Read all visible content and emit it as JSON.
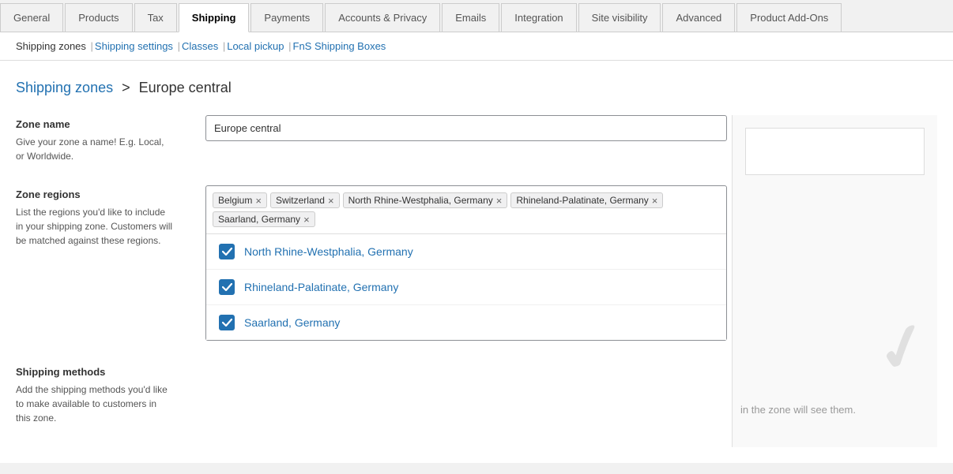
{
  "tabs": [
    {
      "id": "general",
      "label": "General",
      "active": false
    },
    {
      "id": "products",
      "label": "Products",
      "active": false
    },
    {
      "id": "tax",
      "label": "Tax",
      "active": false
    },
    {
      "id": "shipping",
      "label": "Shipping",
      "active": true
    },
    {
      "id": "payments",
      "label": "Payments",
      "active": false
    },
    {
      "id": "accounts-privacy",
      "label": "Accounts & Privacy",
      "active": false
    },
    {
      "id": "emails",
      "label": "Emails",
      "active": false
    },
    {
      "id": "integration",
      "label": "Integration",
      "active": false
    },
    {
      "id": "site-visibility",
      "label": "Site visibility",
      "active": false
    },
    {
      "id": "advanced",
      "label": "Advanced",
      "active": false
    },
    {
      "id": "product-addons",
      "label": "Product Add-Ons",
      "active": false
    }
  ],
  "subnav": {
    "items": [
      {
        "label": "Shipping zones",
        "active": true
      },
      {
        "label": "Shipping settings",
        "active": false
      },
      {
        "label": "Classes",
        "active": false
      },
      {
        "label": "Local pickup",
        "active": false
      },
      {
        "label": "FnS Shipping Boxes",
        "active": false
      }
    ]
  },
  "breadcrumb": {
    "link_text": "Shipping zones",
    "separator": ">",
    "current": "Europe central"
  },
  "zone_name": {
    "label": "Zone name",
    "description_line1": "Give your zone a name! E.g. Local,",
    "description_line2": "or Worldwide.",
    "value": "Europe central",
    "placeholder": "Zone name"
  },
  "zone_regions": {
    "label": "Zone regions",
    "description_line1": "List the regions you'd like to include",
    "description_line2": "in your shipping zone. Customers will",
    "description_line3": "be matched against these regions.",
    "tags": [
      {
        "label": "Belgium"
      },
      {
        "label": "Switzerland"
      },
      {
        "label": "North Rhine-Westphalia, Germany"
      },
      {
        "label": "Rhineland-Palatinate, Germany"
      },
      {
        "label": "Saarland, Germany"
      }
    ],
    "dropdown_items": [
      {
        "label": "North Rhine-Westphalia, Germany",
        "checked": true
      },
      {
        "label": "Rhineland-Palatinate, Germany",
        "checked": true
      },
      {
        "label": "Saarland, Germany",
        "checked": true
      }
    ]
  },
  "shipping_methods": {
    "label": "Shipping methods",
    "description_line1": "Add the shipping methods you'd like",
    "description_line2": "to make available to customers in",
    "description_line3": "this zone."
  },
  "ghost": {
    "text": "in the zone will see them."
  },
  "colors": {
    "accent": "#2271b1",
    "link": "#2271b1",
    "checkbox_bg": "#2271b1"
  }
}
